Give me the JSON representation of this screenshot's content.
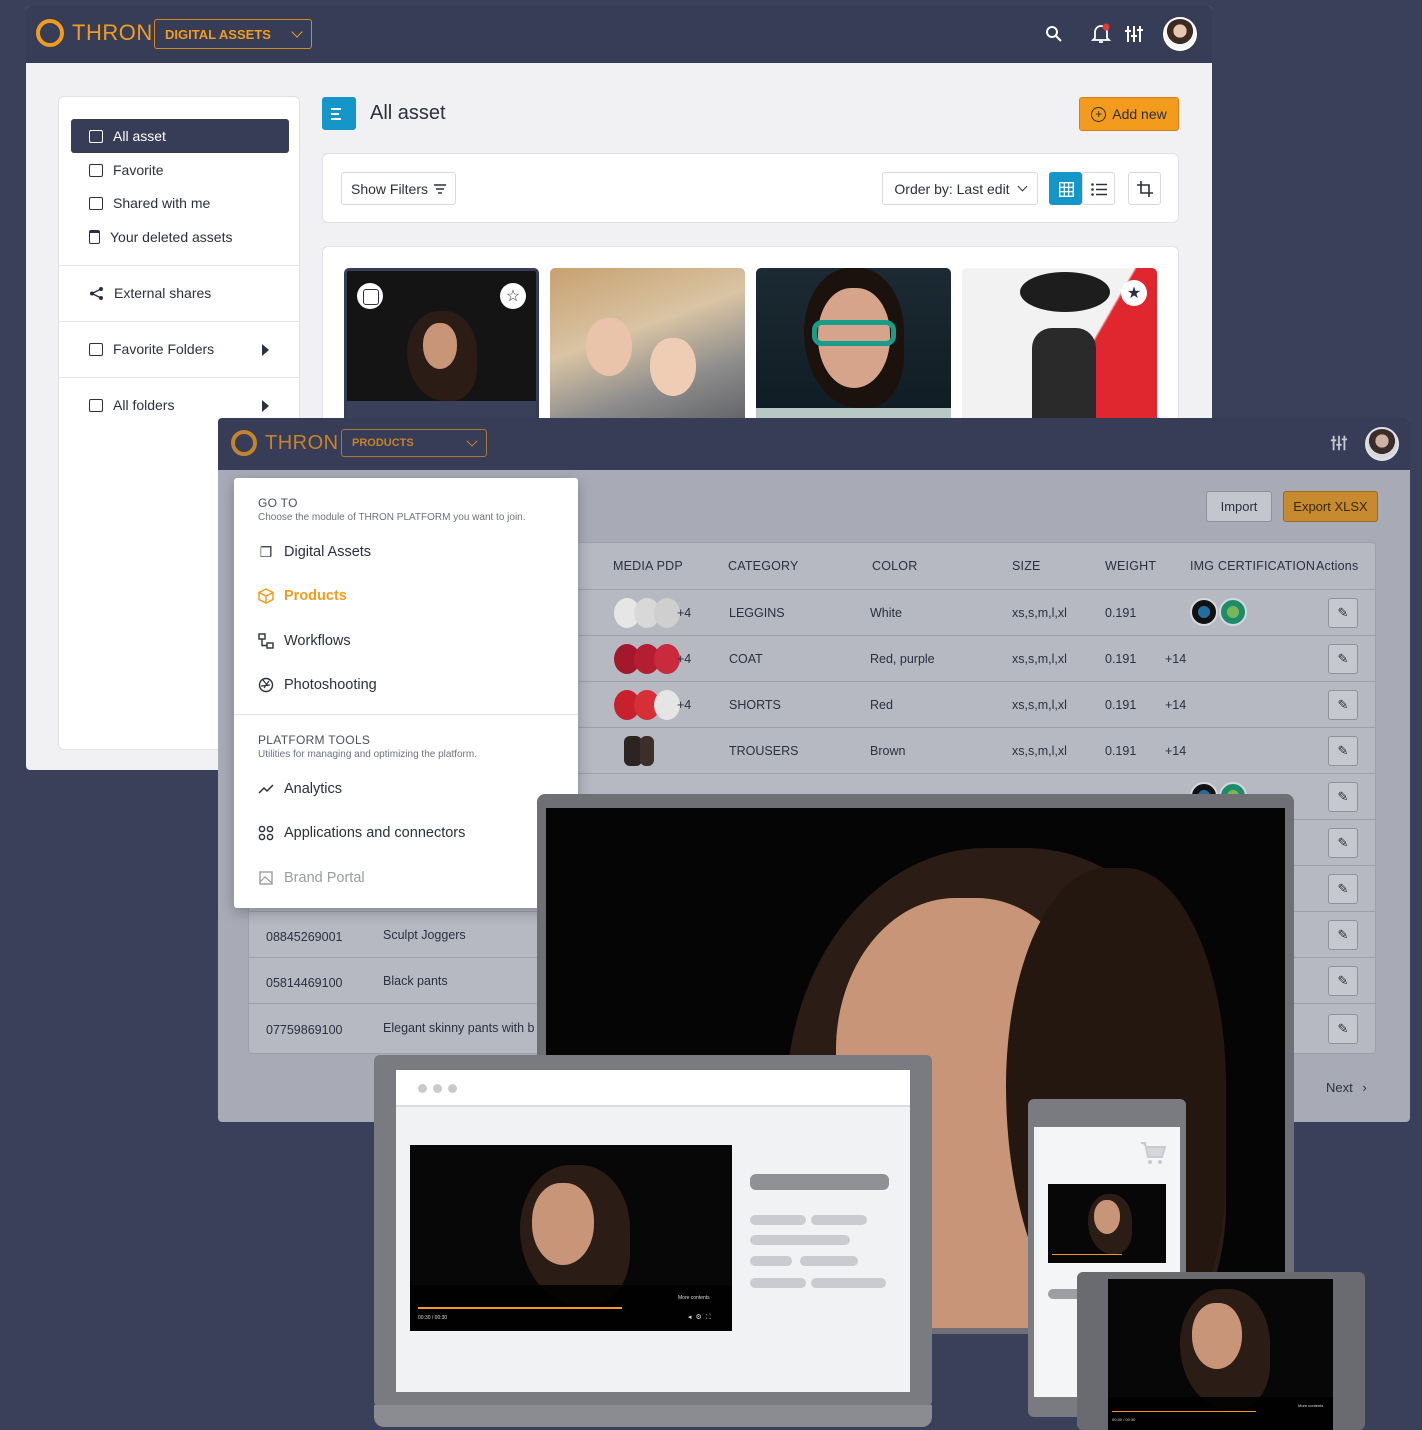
{
  "window1": {
    "brand": "THRON",
    "module": "DIGITAL ASSETS",
    "sidebar": [
      {
        "label": "All asset",
        "active": true
      },
      {
        "label": "Favorite"
      },
      {
        "label": "Shared with me"
      },
      {
        "label": "Your deleted assets"
      },
      {
        "label": "External shares"
      },
      {
        "label": "Favorite Folders"
      },
      {
        "label": "All folders"
      }
    ],
    "title": "All asset",
    "add_new": "Add new",
    "show_filters": "Show Filters",
    "order_by": "Order by: Last edit"
  },
  "window2": {
    "brand": "THRON",
    "module": "PRODUCTS",
    "import": "Import",
    "export": "Export XLSX",
    "columns": [
      "MEDIA PDP",
      "CATEGORY",
      "COLOR",
      "SIZE",
      "WEIGHT",
      "IMG CERTIFICATION",
      "Actions"
    ],
    "rows": [
      {
        "media_more": "+4",
        "category": "LEGGINS",
        "color": "White",
        "size": "xs,s,m,l,xl",
        "weight": "0.191",
        "cert_more": ""
      },
      {
        "media_more": "+4",
        "category": "COAT",
        "color": "Red, purple",
        "size": "xs,s,m,l,xl",
        "weight": "0.191",
        "cert_more": "+14"
      },
      {
        "media_more": "+4",
        "category": "SHORTS",
        "color": "Red",
        "size": "xs,s,m,l,xl",
        "weight": "0.191",
        "cert_more": "+14"
      },
      {
        "media_more": "",
        "category": "TROUSERS",
        "color": "Brown",
        "size": "xs,s,m,l,xl",
        "weight": "0.191",
        "cert_more": "+14"
      }
    ],
    "lower_rows": [
      {
        "code": "08845269001",
        "name": "Sculpt Joggers"
      },
      {
        "code": "05814469100",
        "name": "Black pants"
      },
      {
        "code": "07759869100",
        "name": "Elegant skinny pants with b"
      }
    ],
    "next": "Next"
  },
  "menu": {
    "goto_title": "GO TO",
    "goto_sub": "Choose the module of THRON PLATFORM you want to join.",
    "goto_items": [
      {
        "label": "Digital Assets",
        "icon": "digital-assets-icon"
      },
      {
        "label": "Products",
        "icon": "cube-icon",
        "active": true
      },
      {
        "label": "Workflows",
        "icon": "workflow-icon"
      },
      {
        "label": "Photoshooting",
        "icon": "aperture-icon"
      }
    ],
    "tools_title": "PLATFORM TOOLS",
    "tools_sub": "Utilities for managing and optimizing the platform.",
    "tools_items": [
      {
        "label": "Analytics",
        "icon": "trend-icon"
      },
      {
        "label": "Applications and connectors",
        "icon": "apps-icon"
      },
      {
        "label": "Brand Portal",
        "icon": "image-icon",
        "disabled": true
      }
    ]
  },
  "player": {
    "time": "00:30 / 00:30",
    "more": "More contents"
  },
  "colors": {
    "navy": "#373c57",
    "orange": "#f29c1f",
    "blue": "#1596c9",
    "background": "#3a3f5a"
  }
}
